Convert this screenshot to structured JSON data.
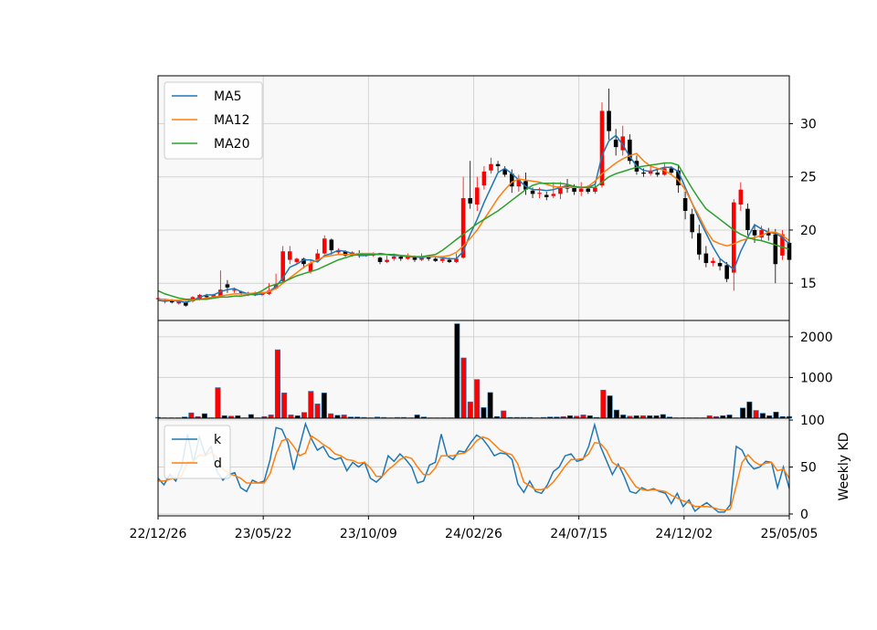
{
  "chart_data": [
    {
      "type": "candlestick",
      "panel": "price",
      "ylim": [
        11.5,
        34.5
      ],
      "yticks": [
        15,
        20,
        25,
        30
      ],
      "grid": true,
      "legend": "top-left",
      "series": [
        {
          "name": "MA5",
          "color": "#1f77b4",
          "values": [
            13.4,
            13.3,
            13.4,
            13.3,
            13.2,
            13.4,
            13.7,
            13.9,
            13.9,
            14.2,
            14.4,
            14.5,
            14.2,
            14.0,
            13.9,
            14.0,
            14.2,
            14.7,
            15.5,
            16.5,
            16.8,
            17.2,
            17.2,
            17.0,
            17.6,
            17.8,
            18.1,
            18.0,
            17.8,
            17.6,
            17.6,
            17.7,
            17.8,
            17.7,
            17.6,
            17.6,
            17.5,
            17.5,
            17.4,
            17.5,
            17.5,
            17.4,
            17.3,
            17.3,
            18.0,
            19.6,
            21.0,
            22.6,
            24.0,
            25.4,
            25.8,
            25.3,
            24.7,
            24.1,
            23.8,
            23.8,
            23.7,
            23.8,
            24.0,
            24.2,
            24.1,
            24.0,
            24.0,
            24.3,
            27.0,
            28.4,
            28.9,
            28.0,
            26.9,
            26.0,
            25.6,
            25.5,
            25.7,
            25.9,
            25.9,
            25.5,
            24.0,
            22.5,
            21.0,
            19.7,
            18.4,
            17.3,
            16.8,
            16.3,
            18.0,
            19.3,
            20.5,
            20.1,
            19.8,
            19.7,
            19.3,
            18.7
          ]
        },
        {
          "name": "MA12",
          "color": "#ff7f0e",
          "values": [
            13.5,
            13.5,
            13.4,
            13.4,
            13.4,
            13.4,
            13.5,
            13.6,
            13.7,
            13.8,
            13.9,
            14.0,
            14.0,
            14.0,
            14.1,
            14.1,
            14.2,
            14.5,
            15.0,
            15.5,
            16.0,
            16.5,
            16.9,
            17.2,
            17.5,
            17.6,
            17.7,
            17.7,
            17.7,
            17.8,
            17.8,
            17.8,
            17.7,
            17.7,
            17.7,
            17.6,
            17.6,
            17.5,
            17.5,
            17.5,
            17.5,
            17.5,
            17.6,
            17.9,
            18.5,
            19.2,
            20.0,
            21.0,
            22.0,
            23.0,
            23.8,
            24.5,
            24.8,
            24.7,
            24.6,
            24.5,
            24.3,
            24.1,
            24.0,
            24.0,
            24.0,
            24.0,
            24.1,
            24.6,
            25.3,
            25.8,
            26.3,
            26.7,
            27.0,
            27.2,
            26.5,
            26.0,
            25.8,
            25.6,
            25.2,
            24.7,
            23.8,
            22.5,
            21.3,
            20.0,
            19.0,
            18.7,
            18.5,
            18.7,
            19.0,
            19.2,
            19.3,
            19.5,
            19.8,
            19.8,
            19.5,
            19.0
          ]
        },
        {
          "name": "MA20",
          "color": "#2ca02c",
          "values": [
            14.3,
            14.0,
            13.8,
            13.6,
            13.5,
            13.5,
            13.5,
            13.5,
            13.6,
            13.7,
            13.7,
            13.8,
            13.8,
            13.9,
            14.0,
            14.3,
            14.7,
            14.9,
            15.1,
            15.4,
            15.7,
            15.9,
            16.1,
            16.3,
            16.6,
            16.9,
            17.2,
            17.4,
            17.6,
            17.7,
            17.7,
            17.7,
            17.7,
            17.7,
            17.7,
            17.6,
            17.5,
            17.5,
            17.5,
            17.6,
            17.7,
            18.1,
            18.6,
            19.1,
            19.6,
            20.1,
            20.6,
            21.0,
            21.4,
            21.8,
            22.3,
            22.8,
            23.3,
            23.8,
            24.2,
            24.4,
            24.4,
            24.4,
            24.4,
            24.3,
            24.1,
            24.0,
            24.0,
            24.0,
            24.5,
            25.0,
            25.3,
            25.5,
            25.7,
            25.9,
            26.0,
            26.1,
            26.2,
            26.3,
            26.3,
            26.1,
            25.0,
            23.9,
            22.9,
            22.0,
            21.5,
            21.0,
            20.5,
            20.0,
            19.6,
            19.3,
            19.1,
            19.0,
            18.8,
            18.6,
            18.4,
            18.2
          ]
        }
      ],
      "ohlc": [
        [
          13.5,
          13.6,
          13.3,
          13.7
        ],
        [
          13.3,
          13.4,
          13.1,
          13.5
        ],
        [
          13.4,
          13.2,
          13.1,
          13.5
        ],
        [
          13.1,
          13.3,
          13.0,
          13.4
        ],
        [
          13.2,
          12.9,
          12.8,
          13.3
        ],
        [
          13.3,
          13.7,
          13.2,
          13.8
        ],
        [
          13.5,
          13.9,
          13.4,
          14.0
        ],
        [
          13.8,
          13.7,
          13.6,
          14.0
        ],
        [
          13.7,
          13.9,
          13.6,
          14.0
        ],
        [
          13.8,
          14.4,
          13.8,
          16.2
        ],
        [
          14.9,
          14.6,
          14.1,
          15.3
        ],
        [
          14.3,
          14.4,
          14.1,
          14.6
        ],
        [
          14.2,
          14.1,
          13.9,
          14.3
        ],
        [
          14.0,
          14.1,
          13.8,
          14.2
        ],
        [
          14.1,
          13.9,
          13.8,
          14.2
        ],
        [
          13.9,
          14.1,
          13.8,
          14.2
        ],
        [
          14.0,
          14.3,
          13.9,
          15.0
        ],
        [
          14.5,
          14.9,
          14.4,
          15.9
        ],
        [
          15.2,
          18.0,
          15.1,
          18.5
        ],
        [
          17.2,
          18.0,
          16.8,
          18.5
        ],
        [
          17.0,
          17.3,
          16.7,
          17.4
        ],
        [
          17.3,
          16.8,
          16.4,
          17.4
        ],
        [
          16.1,
          16.9,
          15.9,
          17.2
        ],
        [
          17.1,
          17.8,
          17.0,
          18.2
        ],
        [
          17.8,
          19.2,
          17.7,
          19.5
        ],
        [
          19.1,
          18.1,
          17.7,
          19.2
        ],
        [
          17.9,
          18.1,
          17.7,
          18.3
        ],
        [
          18.0,
          17.6,
          17.5,
          18.1
        ],
        [
          17.6,
          17.9,
          17.5,
          18.0
        ],
        [
          17.8,
          17.6,
          17.4,
          18.1
        ],
        [
          17.7,
          17.6,
          17.5,
          17.8
        ],
        [
          17.6,
          17.8,
          17.5,
          17.9
        ],
        [
          17.4,
          17.0,
          16.8,
          17.5
        ],
        [
          17.0,
          17.2,
          16.9,
          17.6
        ],
        [
          17.3,
          17.5,
          17.1,
          17.8
        ],
        [
          17.5,
          17.3,
          17.1,
          17.6
        ],
        [
          17.3,
          17.5,
          17.2,
          17.8
        ],
        [
          17.5,
          17.2,
          17.0,
          17.6
        ],
        [
          17.2,
          17.5,
          17.1,
          17.8
        ],
        [
          17.5,
          17.3,
          17.1,
          17.6
        ],
        [
          17.3,
          17.1,
          17.0,
          17.5
        ],
        [
          17.1,
          17.3,
          16.9,
          17.4
        ],
        [
          17.2,
          17.0,
          16.9,
          17.4
        ],
        [
          17.0,
          17.3,
          16.9,
          17.8
        ],
        [
          17.4,
          23.0,
          17.3,
          25.0
        ],
        [
          23.0,
          22.5,
          22.0,
          26.5
        ],
        [
          22.4,
          24.0,
          21.8,
          25.0
        ],
        [
          24.2,
          25.5,
          23.8,
          26.0
        ],
        [
          25.6,
          26.2,
          25.3,
          26.8
        ],
        [
          26.2,
          26.0,
          25.5,
          26.5
        ],
        [
          25.7,
          25.2,
          25.0,
          26.0
        ],
        [
          25.3,
          24.1,
          23.5,
          25.7
        ],
        [
          24.1,
          24.7,
          23.6,
          25.2
        ],
        [
          24.6,
          23.8,
          23.3,
          25.4
        ],
        [
          23.7,
          23.4,
          23.0,
          24.0
        ],
        [
          23.4,
          23.5,
          23.0,
          24.0
        ],
        [
          23.3,
          23.1,
          22.8,
          23.6
        ],
        [
          23.2,
          23.4,
          23.0,
          24.5
        ],
        [
          23.4,
          24.1,
          22.9,
          24.5
        ],
        [
          24.1,
          23.9,
          23.5,
          24.8
        ],
        [
          24.0,
          23.6,
          23.3,
          24.3
        ],
        [
          23.6,
          23.9,
          23.2,
          24.5
        ],
        [
          23.9,
          23.6,
          23.4,
          24.2
        ],
        [
          23.6,
          24.0,
          23.4,
          24.6
        ],
        [
          24.2,
          31.2,
          24.0,
          32.0
        ],
        [
          31.2,
          29.3,
          28.5,
          33.3
        ],
        [
          28.5,
          27.8,
          27.0,
          29.5
        ],
        [
          27.5,
          28.8,
          27.0,
          29.8
        ],
        [
          28.5,
          26.5,
          26.2,
          29.0
        ],
        [
          26.5,
          25.5,
          25.2,
          27.0
        ],
        [
          25.4,
          25.3,
          25.0,
          25.8
        ],
        [
          25.3,
          25.6,
          25.1,
          26.0
        ],
        [
          25.4,
          25.2,
          25.0,
          25.7
        ],
        [
          25.2,
          25.8,
          25.1,
          26.3
        ],
        [
          25.8,
          25.4,
          25.2,
          26.0
        ],
        [
          25.6,
          24.2,
          23.5,
          26.1
        ],
        [
          23.0,
          21.8,
          21.0,
          23.6
        ],
        [
          21.5,
          19.8,
          19.2,
          22.0
        ],
        [
          19.7,
          17.7,
          17.2,
          20.5
        ],
        [
          17.8,
          16.9,
          16.5,
          18.5
        ],
        [
          16.9,
          17.1,
          16.6,
          17.4
        ],
        [
          16.9,
          16.6,
          16.2,
          17.3
        ],
        [
          16.7,
          15.4,
          15.1,
          17.0
        ],
        [
          16.0,
          22.6,
          14.3,
          22.9
        ],
        [
          22.4,
          23.8,
          21.8,
          24.5
        ],
        [
          22.0,
          20.0,
          19.5,
          22.5
        ],
        [
          20.0,
          19.5,
          18.8,
          20.5
        ],
        [
          19.3,
          20.0,
          19.0,
          20.4
        ],
        [
          19.8,
          19.5,
          19.0,
          20.2
        ],
        [
          19.6,
          16.8,
          15.0,
          20.1
        ],
        [
          17.6,
          19.6,
          17.2,
          20.0
        ],
        [
          18.8,
          17.2,
          16.8,
          19.0
        ]
      ]
    },
    {
      "type": "bar",
      "panel": "volume",
      "ylim": [
        0,
        2400
      ],
      "yticks": [
        1000,
        2000
      ],
      "grid": true,
      "values": [
        20,
        10,
        10,
        10,
        30,
        130,
        40,
        110,
        10,
        750,
        60,
        50,
        60,
        10,
        90,
        10,
        40,
        80,
        1680,
        620,
        80,
        60,
        140,
        660,
        350,
        620,
        110,
        70,
        80,
        30,
        30,
        20,
        10,
        30,
        20,
        10,
        20,
        20,
        10,
        80,
        30,
        10,
        10,
        10,
        10,
        2320,
        1480,
        400,
        950,
        260,
        630,
        40,
        180,
        20,
        20,
        20,
        20,
        10,
        20,
        30,
        30,
        40,
        60,
        50,
        80,
        60,
        20,
        690,
        550,
        200,
        80,
        50,
        60,
        60,
        60,
        60,
        90,
        30,
        10,
        10,
        10,
        10,
        10,
        60,
        40,
        60,
        80,
        10,
        250,
        400,
        190,
        120,
        60,
        150,
        40,
        40
      ],
      "colors_up": "#ff0000",
      "colors_down": "#000000"
    },
    {
      "type": "line",
      "panel": "kd",
      "ylabel": "Weekly KD",
      "ylim": [
        -2,
        102
      ],
      "yticks": [
        0,
        50,
        100
      ],
      "grid": true,
      "legend": "top-left",
      "series": [
        {
          "name": "k",
          "color": "#1f77b4",
          "values": [
            38,
            31,
            42,
            35,
            50,
            85,
            55,
            82,
            63,
            72,
            45,
            36,
            42,
            44,
            28,
            24,
            36,
            33,
            35,
            58,
            92,
            90,
            76,
            47,
            72,
            96,
            80,
            68,
            72,
            61,
            58,
            60,
            46,
            55,
            50,
            55,
            38,
            34,
            40,
            62,
            56,
            64,
            58,
            50,
            33,
            35,
            52,
            55,
            85,
            62,
            58,
            67,
            66,
            76,
            84,
            80,
            72,
            62,
            65,
            64,
            58,
            32,
            23,
            35,
            24,
            22,
            31,
            45,
            50,
            62,
            64,
            56,
            58,
            72,
            95,
            72,
            57,
            42,
            53,
            40,
            24,
            22,
            28,
            25,
            27,
            24,
            22,
            11,
            22,
            8,
            15,
            3,
            8,
            12,
            7,
            2,
            2,
            10,
            72,
            68,
            55,
            48,
            50,
            56,
            55,
            28,
            50,
            27
          ]
        },
        {
          "name": "d",
          "color": "#ff7f0e",
          "values": [
            35,
            35,
            37,
            38,
            41,
            55,
            56,
            63,
            62,
            66,
            60,
            48,
            43,
            41,
            38,
            33,
            33,
            33,
            33,
            43,
            64,
            78,
            80,
            72,
            62,
            65,
            83,
            79,
            74,
            70,
            64,
            62,
            58,
            57,
            54,
            55,
            49,
            40,
            40,
            47,
            52,
            58,
            61,
            59,
            50,
            42,
            42,
            49,
            62,
            62,
            62,
            64,
            65,
            70,
            78,
            82,
            80,
            74,
            68,
            65,
            63,
            53,
            34,
            30,
            26,
            26,
            28,
            34,
            42,
            51,
            58,
            58,
            59,
            64,
            76,
            75,
            68,
            55,
            51,
            48,
            38,
            29,
            26,
            25,
            26,
            25,
            24,
            20,
            17,
            14,
            12,
            8,
            8,
            8,
            7,
            5,
            4,
            5,
            30,
            55,
            63,
            56,
            52,
            54,
            55,
            46,
            48,
            38
          ]
        }
      ]
    },
    {
      "type": "x-axis",
      "tick_labels": [
        "22/12/26",
        "23/05/22",
        "23/10/09",
        "24/02/26",
        "24/07/15",
        "24/12/02",
        "25/05/05"
      ]
    }
  ]
}
